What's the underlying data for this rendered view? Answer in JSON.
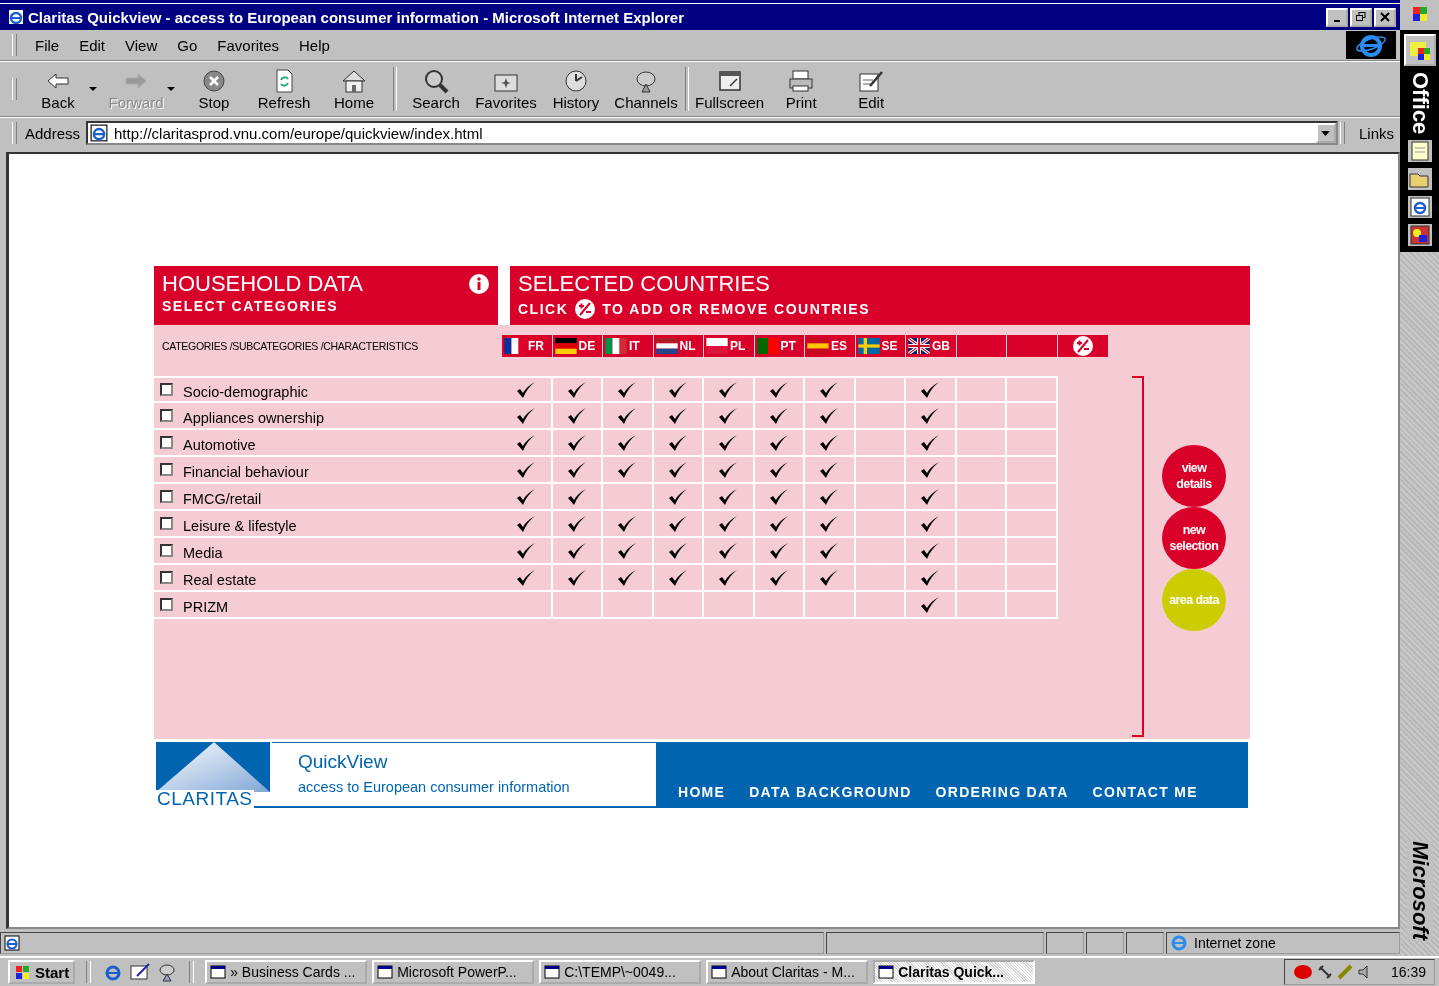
{
  "window": {
    "title": "Claritas Quickview - access to European consumer information - Microsoft Internet Explorer"
  },
  "menu": [
    "File",
    "Edit",
    "View",
    "Go",
    "Favorites",
    "Help"
  ],
  "toolbar": [
    {
      "label": "Back",
      "disabled": false,
      "dropdown": true,
      "separator_after": false
    },
    {
      "label": "Forward",
      "disabled": true,
      "dropdown": true,
      "separator_after": false
    },
    {
      "label": "Stop",
      "disabled": false,
      "dropdown": false,
      "separator_after": false
    },
    {
      "label": "Refresh",
      "disabled": false,
      "dropdown": false,
      "separator_after": false
    },
    {
      "label": "Home",
      "disabled": false,
      "dropdown": false,
      "separator_after": true
    },
    {
      "label": "Search",
      "disabled": false,
      "dropdown": false,
      "separator_after": false
    },
    {
      "label": "Favorites",
      "disabled": false,
      "dropdown": false,
      "separator_after": false
    },
    {
      "label": "History",
      "disabled": false,
      "dropdown": false,
      "separator_after": false
    },
    {
      "label": "Channels",
      "disabled": false,
      "dropdown": false,
      "separator_after": true
    },
    {
      "label": "Fullscreen",
      "disabled": false,
      "dropdown": false,
      "separator_after": false
    },
    {
      "label": "Print",
      "disabled": false,
      "dropdown": false,
      "separator_after": false
    },
    {
      "label": "Edit",
      "disabled": false,
      "dropdown": false,
      "separator_after": false
    }
  ],
  "address": {
    "label": "Address",
    "value": "http://claritasprod.vnu.com/europe/quickview/index.html",
    "links": "Links"
  },
  "office_bar": {
    "title": "Office",
    "brand": "Microsoft"
  },
  "page": {
    "household": {
      "title": "HOUSEHOLD DATA",
      "subtitle": "SELECT CATEGORIES"
    },
    "countries_header": {
      "title": "SELECTED COUNTRIES",
      "click": "CLICK",
      "instruction": "TO ADD OR REMOVE COUNTRIES"
    },
    "columns_label": "CATEGORIES /SUBCATEGORIES /CHARACTERISTICS",
    "columns": [
      {
        "kind": "country",
        "code": "FR"
      },
      {
        "kind": "country",
        "code": "DE"
      },
      {
        "kind": "country",
        "code": "IT"
      },
      {
        "kind": "country",
        "code": "NL"
      },
      {
        "kind": "country",
        "code": "PL"
      },
      {
        "kind": "country",
        "code": "PT"
      },
      {
        "kind": "country",
        "code": "ES"
      },
      {
        "kind": "country",
        "code": "SE"
      },
      {
        "kind": "country",
        "code": "GB"
      },
      {
        "kind": "blank"
      },
      {
        "kind": "blank"
      }
    ],
    "categories": [
      {
        "label": "Socio-demographic",
        "checked": false,
        "checks": [
          true,
          true,
          true,
          true,
          true,
          true,
          true,
          false,
          true,
          false,
          false
        ]
      },
      {
        "label": "Appliances ownership",
        "checked": false,
        "checks": [
          true,
          true,
          true,
          true,
          true,
          true,
          true,
          false,
          true,
          false,
          false
        ]
      },
      {
        "label": "Automotive",
        "checked": false,
        "checks": [
          true,
          true,
          true,
          true,
          true,
          true,
          true,
          false,
          true,
          false,
          false
        ]
      },
      {
        "label": "Financial behaviour",
        "checked": false,
        "checks": [
          true,
          true,
          true,
          true,
          true,
          true,
          true,
          false,
          true,
          false,
          false
        ]
      },
      {
        "label": "FMCG/retail",
        "checked": false,
        "checks": [
          true,
          true,
          false,
          true,
          true,
          true,
          true,
          false,
          true,
          false,
          false
        ]
      },
      {
        "label": "Leisure & lifestyle",
        "checked": false,
        "checks": [
          true,
          true,
          true,
          true,
          true,
          true,
          true,
          false,
          true,
          false,
          false
        ]
      },
      {
        "label": "Media",
        "checked": false,
        "checks": [
          true,
          true,
          true,
          true,
          true,
          true,
          true,
          false,
          true,
          false,
          false
        ]
      },
      {
        "label": "Real estate",
        "checked": false,
        "checks": [
          true,
          true,
          true,
          true,
          true,
          true,
          true,
          false,
          true,
          false,
          false
        ]
      },
      {
        "label": "PRIZM",
        "checked": false,
        "checks": [
          false,
          false,
          false,
          false,
          false,
          false,
          false,
          false,
          true,
          false,
          false
        ]
      }
    ],
    "actions": [
      {
        "label": "view details",
        "color": "#d9002a"
      },
      {
        "label": "new selection",
        "color": "#d9002a"
      },
      {
        "label": "area data",
        "color": "#cccc00"
      }
    ],
    "footer": {
      "logo": "CLARITAS",
      "title": "QuickView",
      "tagline": "access to European consumer information",
      "nav": [
        "HOME",
        "DATA BACKGROUND",
        "ORDERING DATA",
        "CONTACT ME"
      ]
    }
  },
  "status_bar": {
    "zone": "Internet zone"
  },
  "taskbar": {
    "start": "Start",
    "tasks": [
      {
        "label": "» Business Cards ...",
        "selected": false
      },
      {
        "label": "Microsoft PowerP...",
        "selected": false
      },
      {
        "label": "C:\\TEMP\\~0049...",
        "selected": false
      },
      {
        "label": "About Claritas - M...",
        "selected": false
      },
      {
        "label": "Claritas Quick...",
        "selected": true
      }
    ],
    "time": "16:39"
  }
}
